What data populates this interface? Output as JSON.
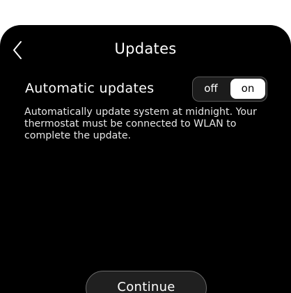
{
  "header": {
    "title": "Updates",
    "back_icon": "chevron-left-icon"
  },
  "setting": {
    "label": "Automatic updates",
    "toggle": {
      "off_label": "off",
      "on_label": "on",
      "selected": "on"
    },
    "description": "Automatically update system at midnight. Your thermostat must be connected to WLAN to complete the update."
  },
  "footer": {
    "continue_label": "Continue"
  },
  "colors": {
    "background": "#000000",
    "text": "#ffffff",
    "toggle_selected": "#ffffff"
  }
}
